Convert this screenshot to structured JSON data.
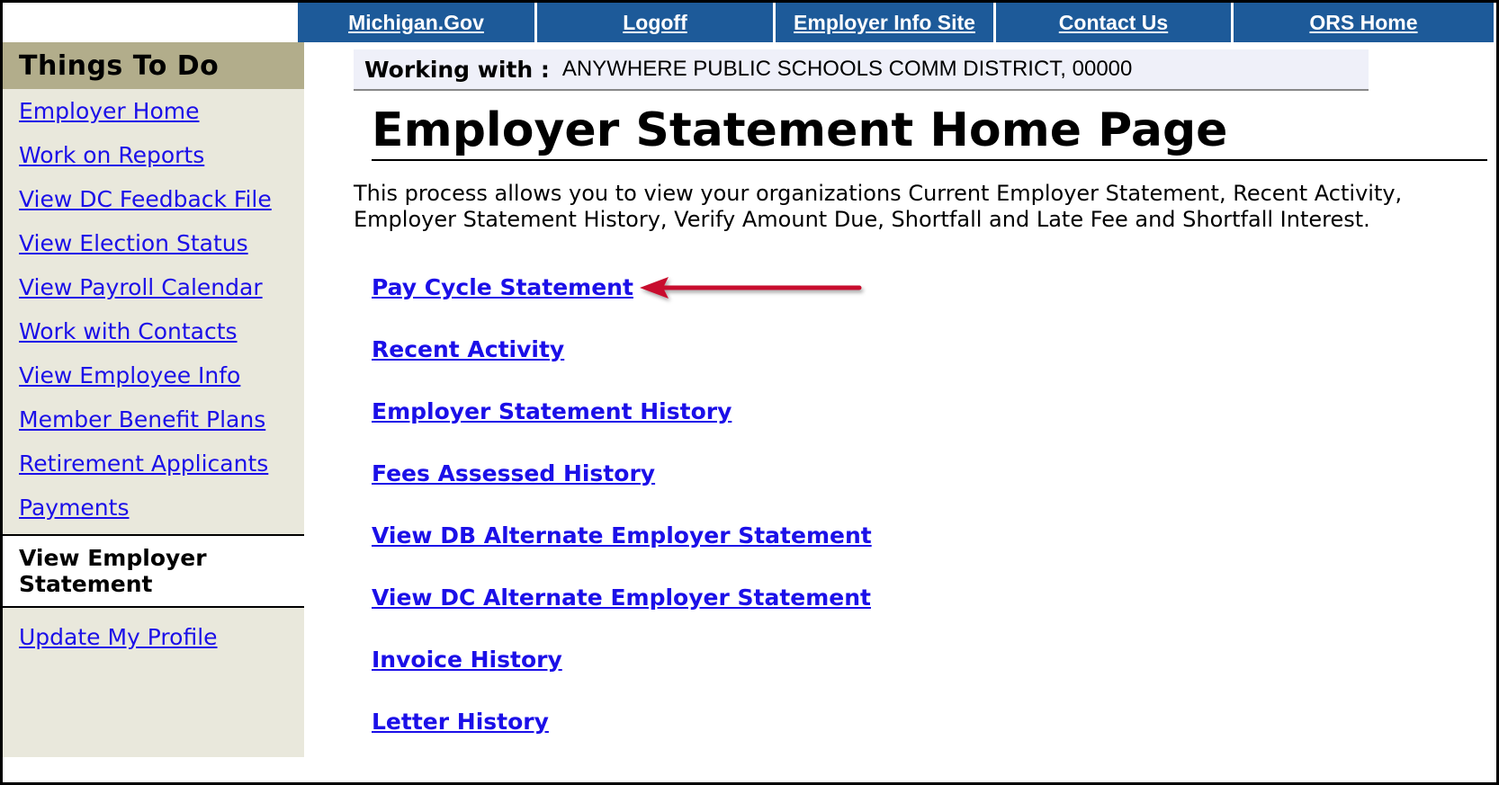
{
  "topnav": {
    "items": [
      {
        "label": "Michigan.Gov"
      },
      {
        "label": "Logoff"
      },
      {
        "label": "Employer Info Site"
      },
      {
        "label": "Contact Us"
      },
      {
        "label": "ORS Home"
      }
    ]
  },
  "sidebar": {
    "title": "Things To Do",
    "items": [
      {
        "label": "Employer Home"
      },
      {
        "label": "Work on Reports"
      },
      {
        "label": "View DC Feedback File"
      },
      {
        "label": "View Election Status"
      },
      {
        "label": "View Payroll Calendar"
      },
      {
        "label": "Work with Contacts"
      },
      {
        "label": "View Employee Info"
      },
      {
        "label": "Member Benefit Plans"
      },
      {
        "label": "Retirement Applicants"
      },
      {
        "label": "Payments"
      }
    ],
    "active_line1": "View Employer",
    "active_line2": "Statement",
    "after_item": "Update My Profile"
  },
  "working": {
    "label": "Working with :",
    "value": "ANYWHERE PUBLIC SCHOOLS COMM DISTRICT, 00000"
  },
  "main": {
    "title": "Employer Statement Home Page",
    "intro_line1": "This process allows you to view your organizations Current Employer Statement, Recent Activity,",
    "intro_line2": "Employer Statement History, Verify Amount Due, Shortfall and Late Fee and Shortfall Interest.",
    "links": [
      {
        "label": "Pay Cycle Statement"
      },
      {
        "label": "Recent Activity"
      },
      {
        "label": "Employer Statement History"
      },
      {
        "label": "Fees Assessed History"
      },
      {
        "label": "View DB Alternate Employer Statement"
      },
      {
        "label": "View DC Alternate Employer Statement"
      },
      {
        "label": "Invoice History"
      },
      {
        "label": "Letter History"
      }
    ]
  },
  "colors": {
    "nav_bg": "#1d5a99",
    "sidebar_bg": "#e9e8dc",
    "sidebar_header_bg": "#b2ad8b",
    "link": "#1b0fe8",
    "arrow": "#c8102e"
  },
  "icons": {
    "annotation": "red-arrow-left-icon"
  }
}
